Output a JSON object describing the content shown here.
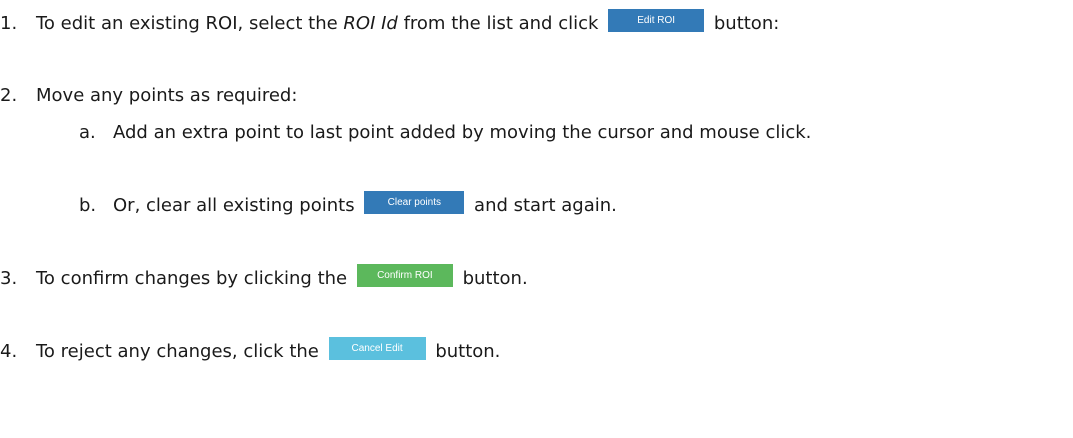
{
  "steps": [
    {
      "number": "1.",
      "text_before": "To edit an existing ROI, select the ",
      "text_italic": "ROI Id",
      "text_middle": " from the list and click ",
      "button_label": "Edit ROI",
      "button_color": "#337ab7",
      "text_after": " button:"
    },
    {
      "number": "2.",
      "text": "Move any points as required:",
      "substeps": [
        {
          "letter": "a.",
          "text": "Add an extra point to last point added by moving the cursor and mouse click."
        },
        {
          "letter": "b.",
          "text_before": "Or, clear all existing points ",
          "button_label": "Clear points",
          "button_color": "#337ab7",
          "text_after": " and start again."
        }
      ]
    },
    {
      "number": "3.",
      "text_before": "To confirm changes by clicking the ",
      "button_label": "Confirm ROI",
      "button_color": "#5cb85c",
      "text_after": " button."
    },
    {
      "number": "4.",
      "text_before": "To reject any changes, click the ",
      "button_label": "Cancel Edit",
      "button_color": "#5bc0de",
      "text_after": " button."
    }
  ]
}
